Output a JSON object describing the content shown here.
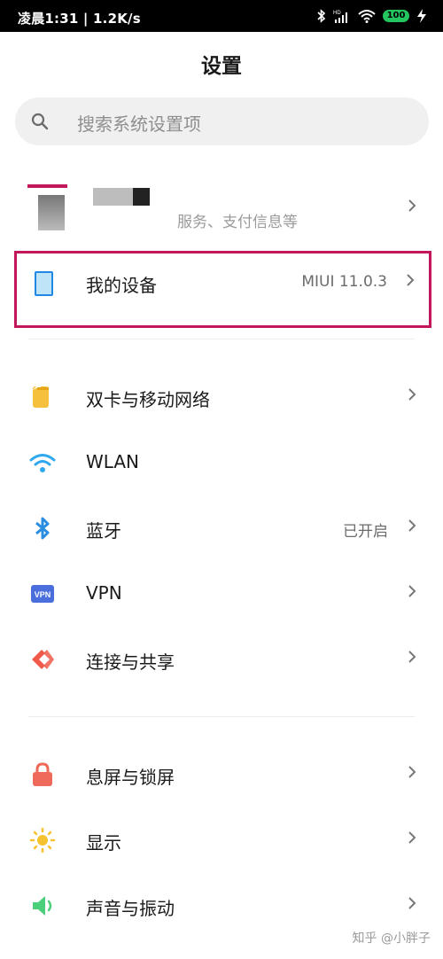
{
  "status_bar": {
    "time": "凌晨1:31 | 1.2K/s",
    "battery": "100",
    "icons": [
      "bluetooth-icon",
      "hd-signal-icon",
      "wifi-icon",
      "battery-icon",
      "charging-icon"
    ]
  },
  "header": {
    "title": "设置"
  },
  "search": {
    "placeholder": "搜索系统设置项"
  },
  "account": {
    "subtitle": "服务、支付信息等"
  },
  "device": {
    "label": "我的设备",
    "value": "MIUI 11.0.3"
  },
  "rows": [
    {
      "label": "双卡与移动网络",
      "value": "",
      "icon": "sim-card-icon"
    },
    {
      "label": "WLAN",
      "value": "",
      "icon": "wifi-icon"
    },
    {
      "label": "蓝牙",
      "value": "已开启",
      "icon": "bluetooth-icon"
    },
    {
      "label": "VPN",
      "value": "",
      "icon": "vpn-icon"
    },
    {
      "label": "连接与共享",
      "value": "",
      "icon": "connection-share-icon"
    },
    {
      "label": "息屏与锁屏",
      "value": "",
      "icon": "lock-icon"
    },
    {
      "label": "显示",
      "value": "",
      "icon": "sun-icon"
    },
    {
      "label": "声音与振动",
      "value": "",
      "icon": "speaker-icon"
    }
  ],
  "vpn_badge": "VPN",
  "watermark": "知乎 @小胖子",
  "colors": {
    "highlight_border": "#c2185b",
    "battery": "#22c55e"
  }
}
